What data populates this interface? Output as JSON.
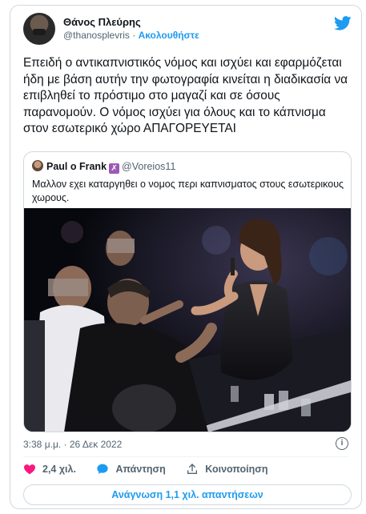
{
  "author": {
    "name": "Θάνος Πλεύρης",
    "handle": "@thanosplevris",
    "separator": "·",
    "follow_label": "Ακολουθήστε"
  },
  "tweet": {
    "text": "Επειδή ο αντικαπνιστικός νόμος και ισχύει και εφαρμόζεται ήδη με βάση αυτήν την φωτογραφία κινείται η διαδικασία να επιβληθεί το πρόστιμο στο μαγαζί και σε όσους παρανομούν. Ο νόμος ισχύει για όλους και το κάπνισμα στον εσωτερικό χώρο ΑΠΑΓΟΡΕΥΕΤΑΙ",
    "timestamp": "3:38 μ.μ. · 26 Δεκ 2022"
  },
  "quoted": {
    "name": "Paul o Frank",
    "badge": "✗",
    "handle": "@Voreios11",
    "text": "Μαλλον εχει καταργηθει ο νομος περι καπνισματος στους εσωτερικους χωρους."
  },
  "actions": {
    "likes": "2,4 χιλ.",
    "reply_label": "Απάντηση",
    "share_label": "Κοινοποίηση"
  },
  "read_replies_label": "Ανάγνωση 1,1 χιλ. απαντήσεων",
  "icons": [
    "twitter-bird-icon",
    "info-icon",
    "heart-icon",
    "reply-bubble-icon",
    "share-icon"
  ],
  "colors": {
    "accent": "#1d9bf0",
    "like": "#f91880",
    "muted": "#536471"
  }
}
